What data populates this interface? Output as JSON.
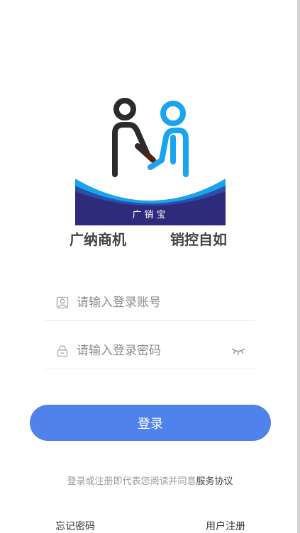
{
  "brand": {
    "logo_text": "广销宝",
    "slogan_left": "广纳商机",
    "slogan_right": "销控自如"
  },
  "form": {
    "account_placeholder": "请输入登录账号",
    "password_placeholder": "请输入登录密码"
  },
  "actions": {
    "login_label": "登录",
    "forgot_label": "忘记密码",
    "register_label": "用户注册"
  },
  "agreement": {
    "prefix": "登录或注册即代表您阅读并同意",
    "link": "服务协议"
  },
  "colors": {
    "primary": "#4f82ea",
    "logo_banner": "#2e2a7c",
    "figure_blue": "#1aa3ef",
    "figure_dark": "#2b2b2b"
  }
}
